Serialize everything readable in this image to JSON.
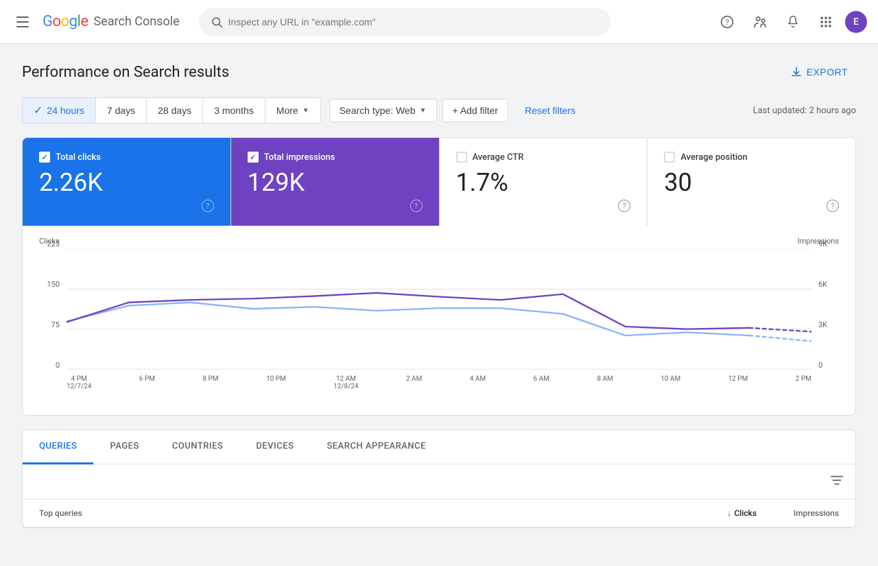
{
  "app": {
    "title": "Google Search Console",
    "logo_letters": [
      "G",
      "o",
      "o",
      "g",
      "l",
      "e"
    ],
    "logo_product": "Search Console"
  },
  "header": {
    "search_placeholder": "Inspect any URL in \"example.com\"",
    "avatar_letter": "E",
    "menu_icon_label": "Main menu"
  },
  "page": {
    "title": "Performance on Search results",
    "export_label": "EXPORT",
    "last_updated": "Last updated: 2 hours ago"
  },
  "filters": {
    "time_options": [
      {
        "label": "24 hours",
        "active": true
      },
      {
        "label": "7 days",
        "active": false
      },
      {
        "label": "28 days",
        "active": false
      },
      {
        "label": "3 months",
        "active": false
      },
      {
        "label": "More",
        "active": false,
        "has_arrow": true
      }
    ],
    "search_type_label": "Search type: Web",
    "add_filter_label": "+ Add filter",
    "reset_filters_label": "Reset filters"
  },
  "metrics": [
    {
      "id": "total-clicks",
      "label": "Total clicks",
      "value": "2.26K",
      "active": true,
      "style": "blue",
      "checked": true
    },
    {
      "id": "total-impressions",
      "label": "Total impressions",
      "value": "129K",
      "active": true,
      "style": "purple",
      "checked": true
    },
    {
      "id": "average-ctr",
      "label": "Average CTR",
      "value": "1.7%",
      "active": false,
      "style": "none",
      "checked": false
    },
    {
      "id": "average-position",
      "label": "Average position",
      "value": "30",
      "active": false,
      "style": "none",
      "checked": false
    }
  ],
  "chart": {
    "y_axis_left_label": "Clicks",
    "y_axis_right_label": "Impressions",
    "y_left_values": [
      "225",
      "150",
      "75",
      "0"
    ],
    "y_right_values": [
      "9K",
      "6K",
      "3K",
      "0"
    ],
    "x_labels": [
      {
        "time": "4 PM",
        "date": "12/7/24"
      },
      {
        "time": "6 PM",
        "date": ""
      },
      {
        "time": "8 PM",
        "date": ""
      },
      {
        "time": "10 PM",
        "date": ""
      },
      {
        "time": "12 AM",
        "date": "12/8/24"
      },
      {
        "time": "2 AM",
        "date": ""
      },
      {
        "time": "4 AM",
        "date": ""
      },
      {
        "time": "6 AM",
        "date": ""
      },
      {
        "time": "8 AM",
        "date": ""
      },
      {
        "time": "10 AM",
        "date": ""
      },
      {
        "time": "12 PM",
        "date": ""
      },
      {
        "time": "2 PM",
        "date": ""
      }
    ]
  },
  "tabs": {
    "items": [
      {
        "label": "QUERIES",
        "active": true
      },
      {
        "label": "PAGES",
        "active": false
      },
      {
        "label": "COUNTRIES",
        "active": false
      },
      {
        "label": "DEVICES",
        "active": false
      },
      {
        "label": "SEARCH APPEARANCE",
        "active": false
      }
    ]
  },
  "table": {
    "col_main": "Top queries",
    "col_clicks": "Clicks",
    "col_impressions": "Impressions",
    "sort_arrow": "↓"
  },
  "icons": {
    "search": "🔍",
    "help": "?",
    "user_group": "👥",
    "bell": "🔔",
    "grid": "⊞",
    "download": "⬇",
    "plus": "+",
    "filter_list": "☰",
    "chevron_down": "▼"
  }
}
